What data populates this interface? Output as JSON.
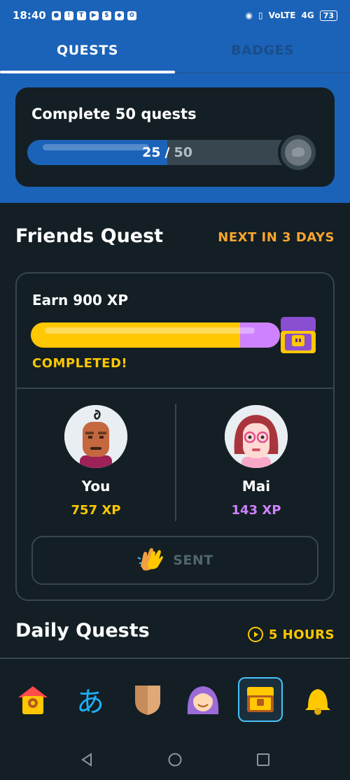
{
  "status_bar": {
    "time": "18:40",
    "network": "VoLTE",
    "signal": "4G",
    "battery": "73"
  },
  "tabs": [
    {
      "label": "QUESTS",
      "active": true
    },
    {
      "label": "BADGES",
      "active": false
    }
  ],
  "badge_card": {
    "title": "Complete 50 quests",
    "current": "25",
    "separator": "/",
    "total": "50",
    "progress_fraction": 0.5
  },
  "friends_quest": {
    "title": "Friends Quest",
    "next_in": "NEXT IN 3 DAYS",
    "goal": "Earn 900 XP",
    "status": "COMPLETED!",
    "participants": [
      {
        "name": "You",
        "xp": "757 XP",
        "xp_value": 757
      },
      {
        "name": "Mai",
        "xp": "143 XP",
        "xp_value": 143
      }
    ],
    "sent_button": "SENT"
  },
  "daily_quests": {
    "title": "Daily Quests",
    "timer": "5 HOURS"
  },
  "bottom_nav": [
    {
      "name": "home",
      "icon": "house-icon",
      "active": false
    },
    {
      "name": "characters",
      "icon": "hiragana-a-icon",
      "glyph": "あ",
      "active": false
    },
    {
      "name": "league",
      "icon": "shield-icon",
      "active": false
    },
    {
      "name": "profile",
      "icon": "avatar-icon",
      "active": false
    },
    {
      "name": "quests",
      "icon": "chest-icon",
      "active": true
    },
    {
      "name": "notifications",
      "icon": "bell-icon",
      "active": false
    }
  ],
  "colors": {
    "brand_blue": "#1b63b8",
    "background": "#131f24",
    "gold": "#ffc800",
    "purple": "#ce82ff",
    "orange": "#f9a530",
    "active_nav": "#49c0f8"
  }
}
